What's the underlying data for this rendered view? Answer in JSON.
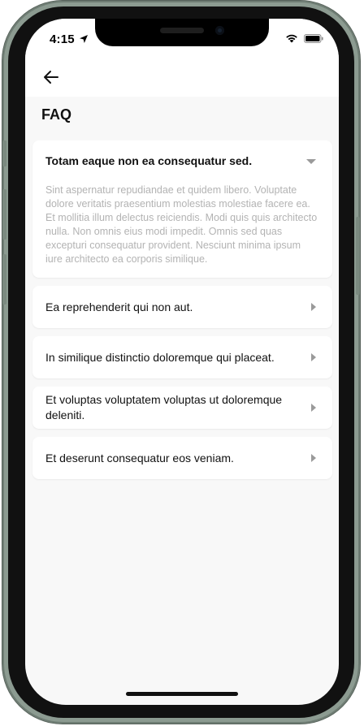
{
  "status_bar": {
    "time": "4:15",
    "location_icon": "location-arrow-icon",
    "wifi_icon": "wifi-icon",
    "battery_icon": "battery-icon"
  },
  "header": {
    "back_icon": "arrow-left-icon"
  },
  "page": {
    "title": "FAQ"
  },
  "faq": {
    "items": [
      {
        "question": "Totam eaque non ea consequatur sed.",
        "answer": "Sint aspernatur repudiandae et quidem libero. Voluptate dolore veritatis praesentium molestias molestiae facere ea. Et mollitia illum delectus reiciendis. Modi quis quis architecto nulla. Non omnis eius modi impedit. Omnis sed quas excepturi consequatur provident. Nesciunt minima ipsum iure architecto ea corporis similique.",
        "expanded": true,
        "icon": "caret-down-icon"
      },
      {
        "question": "Ea reprehenderit qui non aut.",
        "expanded": false,
        "icon": "caret-right-icon"
      },
      {
        "question": "In similique distinctio doloremque qui placeat.",
        "expanded": false,
        "icon": "caret-right-icon"
      },
      {
        "question": "Et voluptas voluptatem voluptas ut doloremque deleniti.",
        "expanded": false,
        "icon": "caret-right-icon"
      },
      {
        "question": "Et deserunt consequatur eos veniam.",
        "expanded": false,
        "icon": "caret-right-icon"
      }
    ]
  },
  "colors": {
    "frame": "#8c9b91",
    "background": "#f8f8f8",
    "card": "#ffffff",
    "answer_text": "#b3b3b3",
    "chevron": "#9a9a9a"
  }
}
